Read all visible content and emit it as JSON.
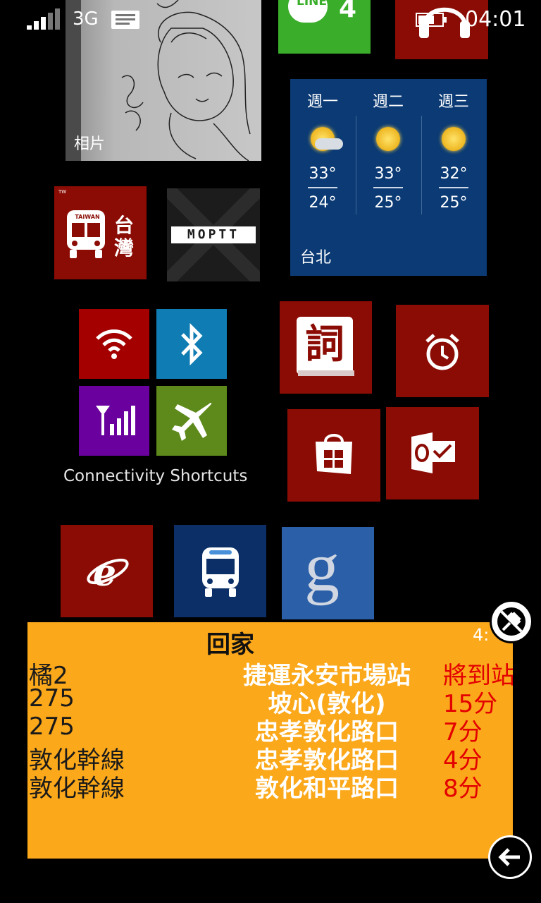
{
  "status_bar": {
    "network": "3G",
    "time": "04:01"
  },
  "tiles": {
    "photos": {
      "label": "相片",
      "icon": "photo-sketch"
    },
    "line": {
      "label": "LINE",
      "count": "4",
      "color": "#3aae2a"
    },
    "music": {
      "icon": "headphones-icon",
      "color": "#8b0c04"
    },
    "weather": {
      "city": "台北",
      "color": "#0b3a74",
      "days": [
        {
          "day": "週一",
          "icon": "partly-cloudy-icon",
          "high": "33°",
          "low": "24°"
        },
        {
          "day": "週二",
          "icon": "sunny-icon",
          "high": "33°",
          "low": "25°"
        },
        {
          "day": "週三",
          "icon": "sunny-icon",
          "high": "32°",
          "low": "25°"
        }
      ]
    },
    "taiwan_bus": {
      "badge": "TAIWAN",
      "corner": "TW",
      "text_top": "台",
      "text_bottom": "灣",
      "color": "#8b0c04"
    },
    "moptt": {
      "label": "MOPTT",
      "color": "#1c1c1c"
    },
    "connectivity": {
      "label": "Connectivity Shortcuts",
      "items": [
        {
          "name": "wifi",
          "icon": "wifi-icon",
          "color": "#a40000"
        },
        {
          "name": "bluetooth",
          "icon": "bluetooth-icon",
          "color": "#0f7cb3"
        },
        {
          "name": "cellular",
          "icon": "cellular-icon",
          "color": "#6a009e"
        },
        {
          "name": "airplane",
          "icon": "airplane-icon",
          "color": "#5d8a1a"
        }
      ]
    },
    "dictionary": {
      "label": "詞",
      "icon": "dictionary-icon",
      "color": "#8b0c04"
    },
    "alarm": {
      "icon": "alarm-icon",
      "color": "#8b0c04"
    },
    "store": {
      "icon": "store-icon",
      "color": "#8b0c04"
    },
    "outlook": {
      "icon": "outlook-icon",
      "color": "#8b0c04"
    },
    "ie": {
      "icon": "internet-explorer-icon",
      "color": "#8b0c04"
    },
    "bus": {
      "icon": "bus-icon",
      "color": "#0b2f66"
    },
    "google": {
      "icon": "google-icon",
      "color": "#2b5fa8"
    }
  },
  "widget": {
    "title": "回家",
    "time_partial": "4:",
    "color": "#fba81a",
    "rows": [
      {
        "route": "橘2",
        "stop": "捷運永安市場站",
        "eta": "將到站"
      },
      {
        "route": "275",
        "stop": "坡心(敦化)",
        "eta": "15分"
      },
      {
        "route": "275",
        "stop": "忠孝敦化路口",
        "eta": "7分"
      },
      {
        "route": "敦化幹線",
        "stop": "忠孝敦化路口",
        "eta": "4分"
      },
      {
        "route": "敦化幹線",
        "stop": "敦化和平路口",
        "eta": "8分"
      }
    ]
  },
  "controls": {
    "unpin": {
      "icon": "unpin-icon"
    },
    "back": {
      "icon": "back-arrow-icon"
    }
  }
}
